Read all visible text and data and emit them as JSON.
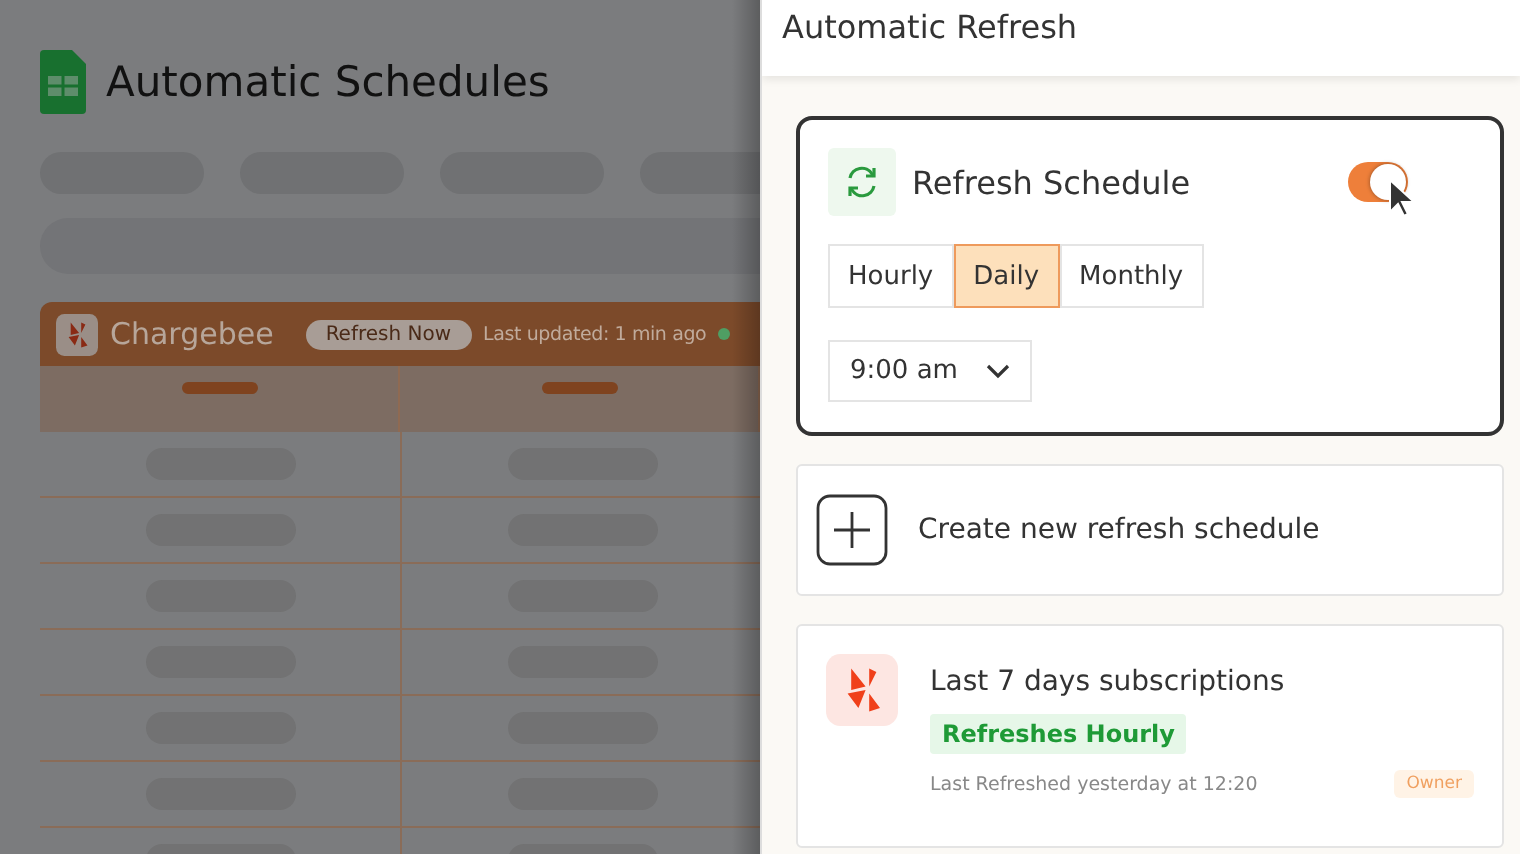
{
  "background_app": {
    "title": "Automatic Schedules",
    "source_card": {
      "name": "Chargebee",
      "refresh_button": "Refresh Now",
      "last_updated": "Last updated: 1 min ago"
    }
  },
  "panel": {
    "title": "Automatic Refresh",
    "schedule_card": {
      "title": "Refresh Schedule",
      "enabled": true,
      "frequencies": [
        {
          "label": "Hourly",
          "selected": false
        },
        {
          "label": "Daily",
          "selected": true
        },
        {
          "label": "Monthly",
          "selected": false
        }
      ],
      "time": "9:00 am"
    },
    "create_button": "Create new refresh schedule",
    "schedules": [
      {
        "name": "Last 7 days subscriptions",
        "frequency": "Refreshes Hourly",
        "last_refreshed": "Last Refreshed yesterday at 12:20",
        "role": "Owner"
      }
    ]
  }
}
